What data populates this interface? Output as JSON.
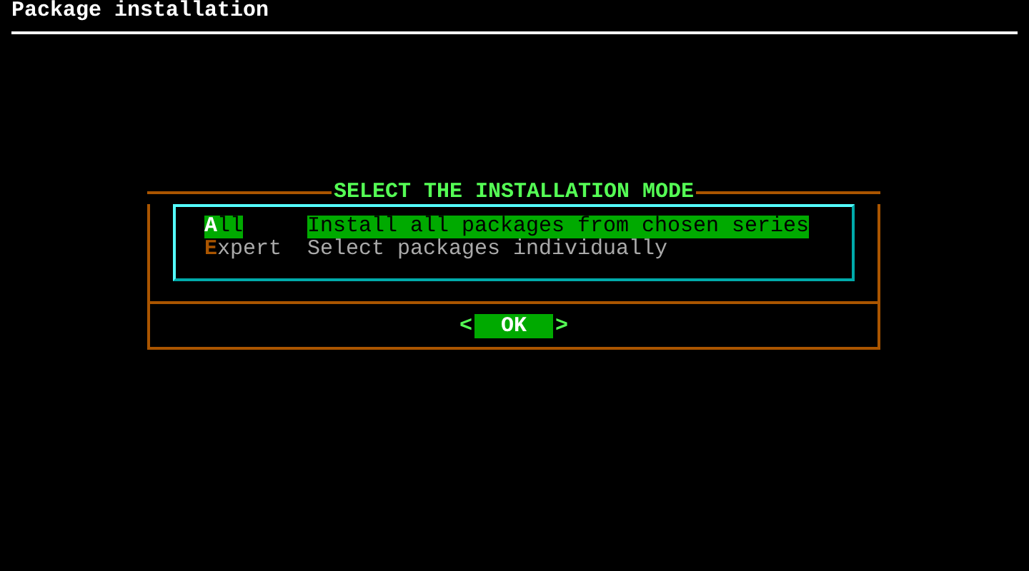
{
  "window": {
    "title": "Package installation"
  },
  "dialog": {
    "title": "SELECT THE INSTALLATION MODE",
    "items": [
      {
        "tag": "All",
        "description": "Install all packages from chosen series",
        "selected": true
      },
      {
        "tag": "Expert",
        "description": "Select packages individually",
        "selected": false
      }
    ],
    "button": {
      "label": "OK",
      "left_mark": "<",
      "right_mark": ">",
      "selected": true
    }
  }
}
